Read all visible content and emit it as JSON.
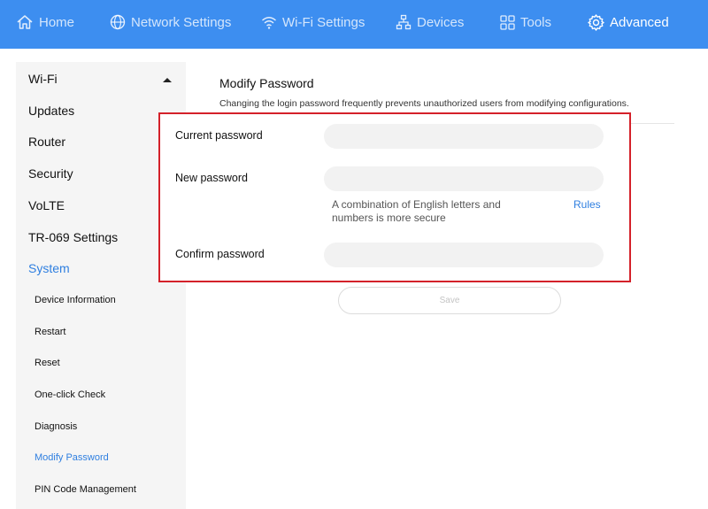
{
  "nav": {
    "home": "Home",
    "network": "Network Settings",
    "wifi": "Wi-Fi Settings",
    "devices": "Devices",
    "tools": "Tools",
    "advanced": "Advanced"
  },
  "sidebar": {
    "items": [
      {
        "label": "Wi-Fi"
      },
      {
        "label": "Updates"
      },
      {
        "label": "Router"
      },
      {
        "label": "Security"
      },
      {
        "label": "VoLTE"
      },
      {
        "label": "TR-069 Settings"
      },
      {
        "label": "System"
      }
    ],
    "sub_items": [
      {
        "label": "Device Information"
      },
      {
        "label": "Restart"
      },
      {
        "label": "Reset"
      },
      {
        "label": "One-click Check"
      },
      {
        "label": "Diagnosis"
      },
      {
        "label": "Modify Password"
      },
      {
        "label": "PIN Code Management"
      }
    ]
  },
  "main": {
    "title": "Modify Password",
    "description": "Changing the login password frequently prevents unauthorized users from modifying configurations.",
    "current_label": "Current password",
    "new_label": "New password",
    "confirm_label": "Confirm password",
    "current_value": "",
    "new_value": "",
    "confirm_value": "",
    "hint": "A combination of English letters and numbers is more secure",
    "rules_link": "Rules",
    "save_label": "Save"
  },
  "colors": {
    "topbar": "#3d8ef0",
    "accent": "#2f7fe0",
    "highlight_border": "#d4212a"
  }
}
